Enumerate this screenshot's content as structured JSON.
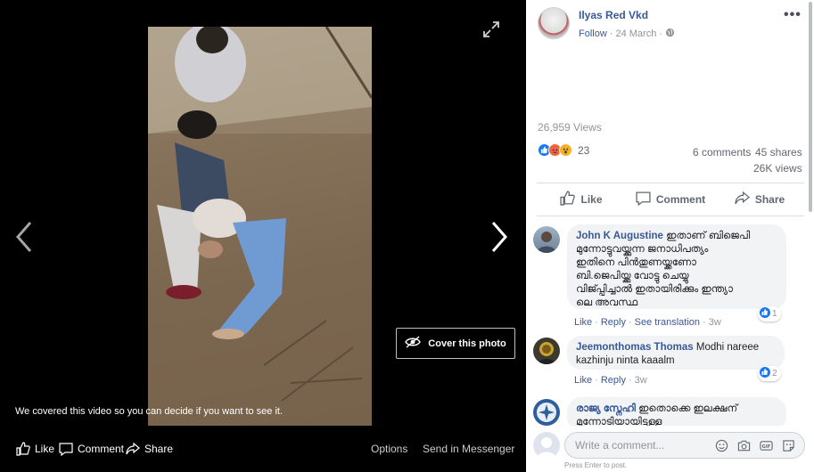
{
  "viewer": {
    "covered_message": "We covered this video so you can decide if you want to see it.",
    "cover_button_label": "Cover this photo",
    "bottom_bar": {
      "like": "Like",
      "comment": "Comment",
      "share": "Share",
      "options": "Options",
      "send_in_messenger": "Send in Messenger"
    }
  },
  "post": {
    "author": "Ilyas Red Vkd",
    "follow": "Follow",
    "date": "24 March",
    "separator": "·",
    "views_line": "26,959 Views",
    "reaction_count": "23",
    "reaction_icons": [
      "like-reaction-icon",
      "angry-reaction-icon",
      "wow-reaction-icon"
    ],
    "comments_count": "6 comments",
    "shares_count": "45 shares",
    "views_count": "26K views",
    "actions": {
      "like": "Like",
      "comment": "Comment",
      "share": "Share"
    }
  },
  "comments": [
    {
      "name": "John K Augustine",
      "text_lines": [
        "ഇതാണ് ബിജെപി",
        "മുന്നോട്ടുവയ്ക്കുന്ന ജനാധിപത്യം",
        "ഇതിനെ പിൻതുണയ്ക്കണോ",
        "ബി.ജെപിയ്ക്കു വോട്ടു ചെയ്യു",
        "വിജ്പ്പിച്ചാൽ ഇതായിരിക്കും ഇന്ത്യാ",
        "ലെ അവസ്ഥ"
      ],
      "actions": [
        "Like",
        "Reply",
        "See translation",
        "3w"
      ],
      "reactions": "1"
    },
    {
      "name": "Jeemonthomas Thomas",
      "text_lines": [
        "Modhi nareee",
        "kazhinju ninta kaaalm"
      ],
      "actions": [
        "Like",
        "Reply",
        "3w"
      ],
      "reactions": "2"
    },
    {
      "name": "രാജ്യ സ്നേഹി",
      "text_lines": [
        "ഇതൊക്കെ ഇലക്ഷന്",
        "മുന്നോടിയായിട്ടുള്ള"
      ],
      "actions": [],
      "reactions": ""
    }
  ],
  "composer": {
    "placeholder": "Write a comment...",
    "hint": "Press Enter to post."
  },
  "colors": {
    "link": "#385898",
    "muted": "#90949c",
    "like_blue": "#1877f2"
  }
}
